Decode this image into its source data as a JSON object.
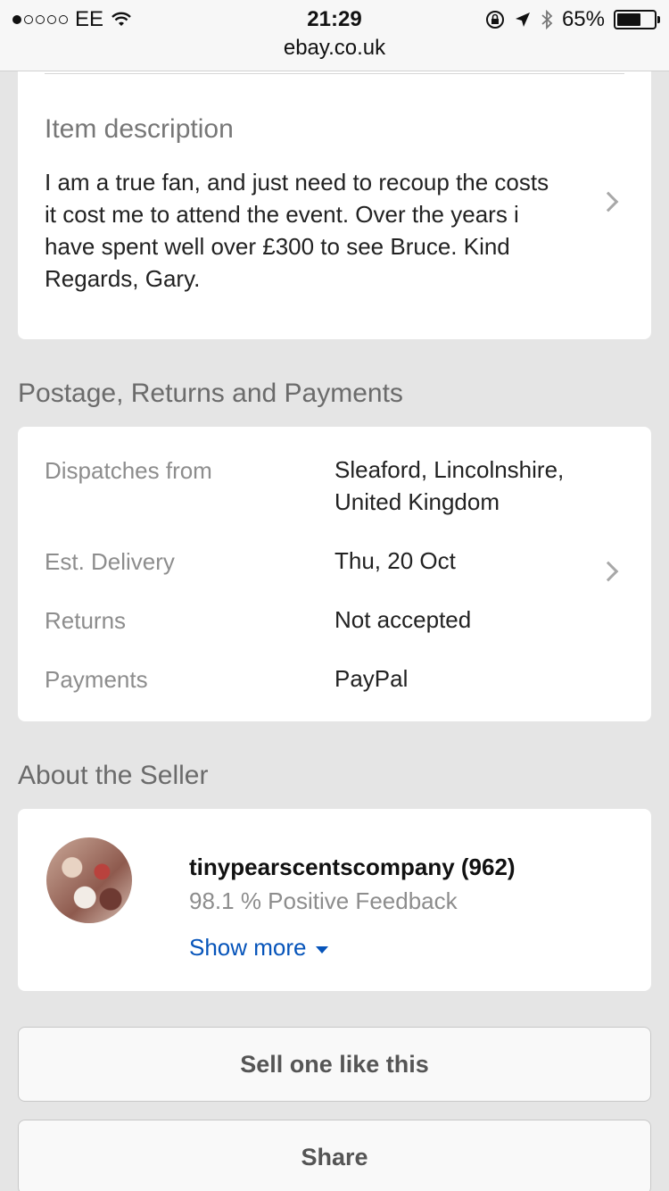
{
  "status_bar": {
    "carrier": "EE",
    "time": "21:29",
    "battery_percent": "65%",
    "battery_level": 0.65,
    "signal_bars": 1,
    "url": "ebay.co.uk"
  },
  "description": {
    "label": "Item description",
    "text": "I am a true fan, and just need to recoup the costs it cost me to attend the event. Over the years i have spent well over £300 to see Bruce. Kind Regards, Gary."
  },
  "postage": {
    "title": "Postage, Returns and Payments",
    "rows": [
      {
        "label": "Dispatches from",
        "value": "Sleaford, Lincolnshire, United Kingdom"
      },
      {
        "label": "Est. Delivery",
        "value": "Thu, 20 Oct"
      },
      {
        "label": "Returns",
        "value": "Not accepted"
      },
      {
        "label": "Payments",
        "value": "PayPal"
      }
    ]
  },
  "seller": {
    "title": "About the Seller",
    "name": "tinypearscentscompany (962)",
    "feedback": "98.1 % Positive Feedback",
    "show_more": "Show more"
  },
  "buttons": {
    "sell_one": "Sell one like this",
    "share": "Share"
  },
  "colors": {
    "link": "#0654ba",
    "background": "#e5e5e5"
  }
}
